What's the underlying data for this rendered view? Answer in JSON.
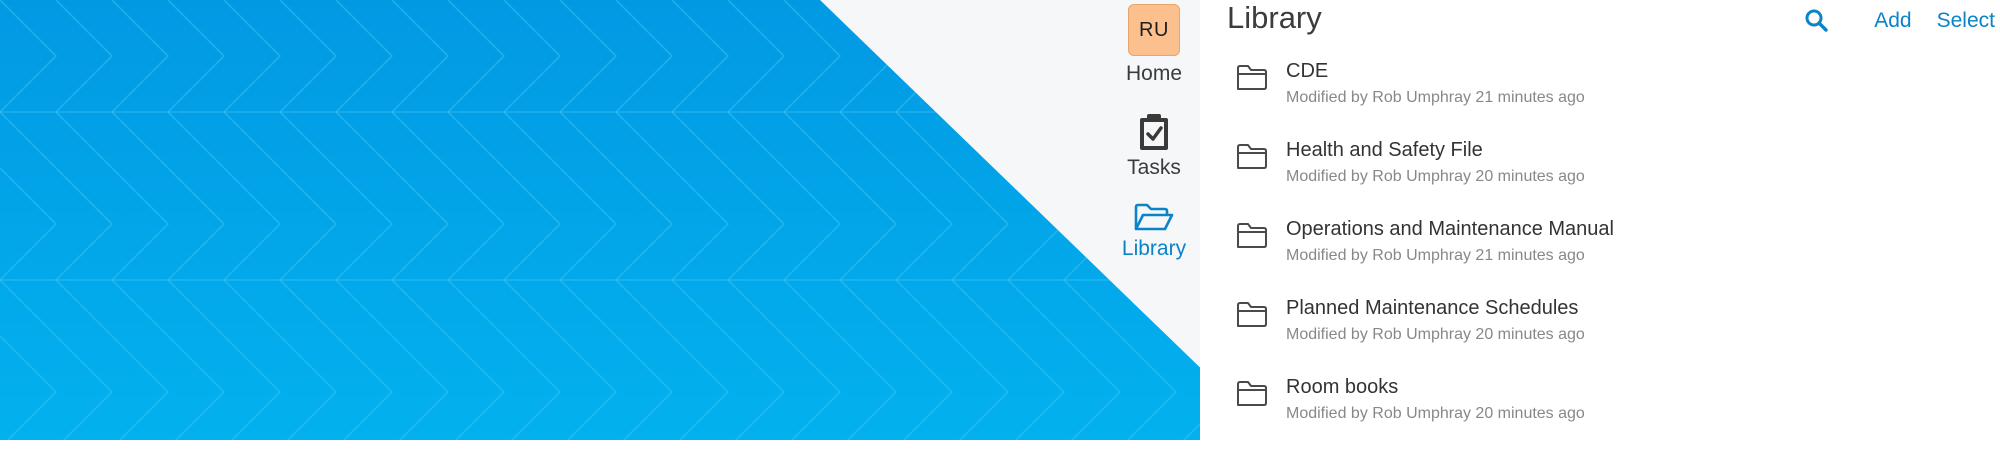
{
  "colors": {
    "accent": "#0a84c6",
    "background_blue": "#03a6e8",
    "rail_background": "#f6f7f9",
    "avatar_fill": "#fbc08e"
  },
  "nav": {
    "items": [
      {
        "label": "Home",
        "avatar_initials": "RU",
        "icon": "avatar"
      },
      {
        "label": "Tasks",
        "icon": "clipboard-check-icon"
      },
      {
        "label": "Library",
        "icon": "folder-open-icon",
        "active": true
      }
    ]
  },
  "header": {
    "title": "Library",
    "search_icon": "search-icon",
    "add_label": "Add",
    "select_label": "Select"
  },
  "folders": [
    {
      "name": "CDE",
      "meta": "Modified by Rob Umphray 21 minutes ago"
    },
    {
      "name": "Health and Safety File",
      "meta": "Modified by Rob Umphray 20 minutes ago"
    },
    {
      "name": "Operations and Maintenance Manual",
      "meta": "Modified by Rob Umphray 21 minutes ago"
    },
    {
      "name": "Planned Maintenance Schedules",
      "meta": "Modified by Rob Umphray 20 minutes ago"
    },
    {
      "name": "Room books",
      "meta": "Modified by Rob Umphray 20 minutes ago"
    }
  ]
}
